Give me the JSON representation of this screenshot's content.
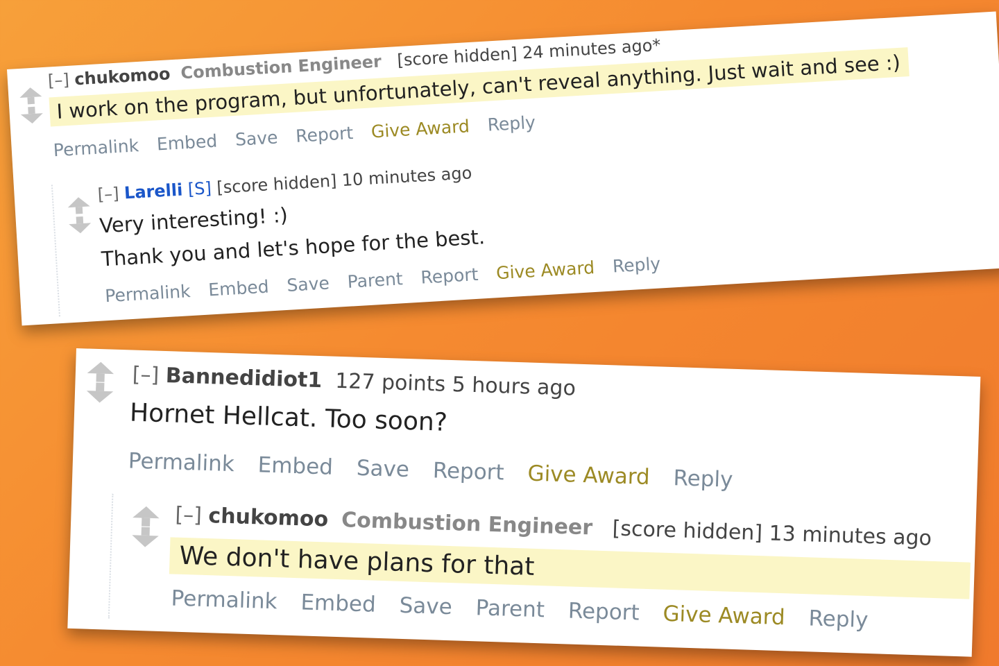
{
  "top_card": {
    "parent": {
      "collapse": "[–]",
      "author": "chukomoo",
      "flair": "Combustion Engineer",
      "meta": "[score hidden] 24 minutes ago*",
      "text": "I work on the program, but unfortunately, can't reveal anything. Just wait and see :)",
      "buttons": [
        "Permalink",
        "Embed",
        "Save",
        "Report",
        "Give Award",
        "Reply"
      ]
    },
    "reply": {
      "collapse": "[–]",
      "author": "Larelli",
      "submitter_tag": "[S]",
      "meta": "[score hidden] 10 minutes ago",
      "text_line1": "Very interesting! :)",
      "text_line2": "Thank you and let's hope for the best.",
      "buttons": [
        "Permalink",
        "Embed",
        "Save",
        "Parent",
        "Report",
        "Give Award",
        "Reply"
      ]
    }
  },
  "bottom_card": {
    "parent": {
      "collapse": "[–]",
      "author": "Bannedidiot1",
      "meta": "127 points 5 hours ago",
      "text": "Hornet Hellcat. Too soon?",
      "buttons": [
        "Permalink",
        "Embed",
        "Save",
        "Report",
        "Give Award",
        "Reply"
      ]
    },
    "reply": {
      "collapse": "[–]",
      "author": "chukomoo",
      "flair": "Combustion Engineer",
      "meta": "[score hidden] 13 minutes ago",
      "text": "We don't have plans for that",
      "buttons": [
        "Permalink",
        "Embed",
        "Save",
        "Parent",
        "Report",
        "Give Award",
        "Reply"
      ]
    }
  },
  "colors": {
    "background": "#f58a30",
    "highlight": "#fbf6c6",
    "link_gray": "#7a8a99",
    "award_gold": "#9c8a24",
    "author_blue": "#1a56c9"
  }
}
